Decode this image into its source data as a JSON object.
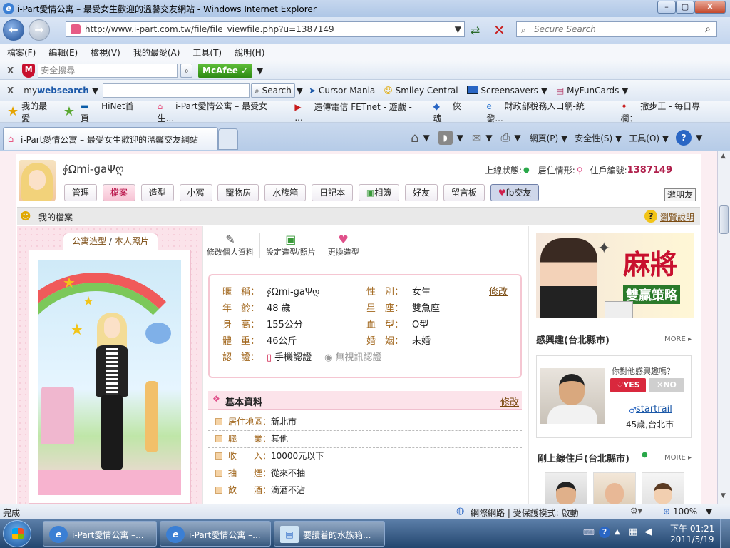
{
  "window": {
    "title": "i-Part愛情公寓 – 最受女生歡迎的溫馨交友網站 - Windows Internet Explorer",
    "minimize": "–",
    "maximize": "▢",
    "close": "X"
  },
  "addressbar": {
    "url": "http://www.i-part.com.tw/file/file_viewfile.php?u=1387149",
    "search_placeholder": "Secure Search"
  },
  "menu": [
    "檔案(F)",
    "編輯(E)",
    "檢視(V)",
    "我的最愛(A)",
    "工具(T)",
    "說明(H)"
  ],
  "toolbar1": {
    "search_placeholder": "安全搜尋",
    "mcafee": "McAfee"
  },
  "toolbar2": {
    "brand_prefix": "my",
    "brand_main": "websearch",
    "search_button": "Search",
    "links": [
      "Cursor Mania",
      "Smiley Central",
      "Screensavers",
      "MyFunCards"
    ]
  },
  "favbar": {
    "label": "我的最愛",
    "items": [
      "HiNet首頁",
      "i-Part愛情公寓 – 最受女生...",
      "遠傳電信 FETnet - 遊戲 - ...",
      "俠魂",
      "財政部稅務入口網-統一發...",
      "撒步王 - 每日專欄："
    ]
  },
  "tab": {
    "title": "i-Part愛情公寓 – 最受女生歡迎的溫馨交友網站"
  },
  "commandbar": [
    "網頁(P)",
    "安全性(S)",
    "工具(O)"
  ],
  "profile": {
    "nickname": "∮Ωmi-gaΨღ",
    "online_label": "上線狀態:",
    "living_label": "居住情形:",
    "resident_label": "住戶編號:",
    "resident_no": "1387149",
    "nav": [
      "管理",
      "檔案",
      "造型",
      "小窩",
      "寵物房",
      "水族箱",
      "日記本",
      "相簿",
      "好友",
      "留言板",
      "fb交友"
    ],
    "invite": "邀朋友",
    "section_title": "我的檔案",
    "help": "瀏覽說明",
    "photo_link1": "公寓造型",
    "photo_sep": "/",
    "photo_link2": "本人照片",
    "actions": [
      "修改個人資料",
      "設定造型/照片",
      "更換造型"
    ],
    "info": {
      "nick_label": "暱　稱：",
      "nick": "∮Ωmi-gaΨღ",
      "gender_label": "性　別：",
      "gender": "女生",
      "edit": "修改",
      "age_label": "年　齡：",
      "age": "48 歲",
      "sign_label": "星　座：",
      "sign": "雙魚座",
      "height_label": "身　高：",
      "height": "155公分",
      "blood_label": "血　型：",
      "blood": "O型",
      "weight_label": "體　重：",
      "weight": "46公斤",
      "marriage_label": "婚　姻：",
      "marriage": "未婚",
      "verify_label": "認　證：",
      "verify_phone": "手機認證",
      "verify_video": "無視訊認證"
    },
    "basic": {
      "title": "基本資料",
      "edit": "修改",
      "rows": [
        {
          "k": "居住地區：",
          "v": "新北市"
        },
        {
          "k": "職　　業：",
          "v": "其他"
        },
        {
          "k": "收　　入：",
          "v": "10000元以下"
        },
        {
          "k": "抽　　煙：",
          "v": "從來不抽"
        },
        {
          "k": "飲　　酒：",
          "v": "滴酒不沾"
        }
      ]
    },
    "ad": {
      "title": "麻將",
      "subtitle": "雙贏策略"
    },
    "interest": {
      "title": "感興趣(台北縣市)",
      "more": "MORE",
      "question": "你對他感興趣嗎？",
      "yes": "YES",
      "no": "NO",
      "user": "startrail",
      "user_info": "45歲,台北市"
    },
    "recent": {
      "title": "剛上線住戶(台北縣市)",
      "more": "MORE"
    }
  },
  "status": {
    "text": "完成",
    "zone": "網際網路 | 受保護模式: 啟動",
    "zoom": "100%"
  },
  "taskbar": {
    "items": [
      "i-Part愛情公寓 –...",
      "i-Part愛情公寓 –...",
      "要讀着的水族箱..."
    ],
    "time": "下午 01:21",
    "date": "2011/5/19"
  }
}
